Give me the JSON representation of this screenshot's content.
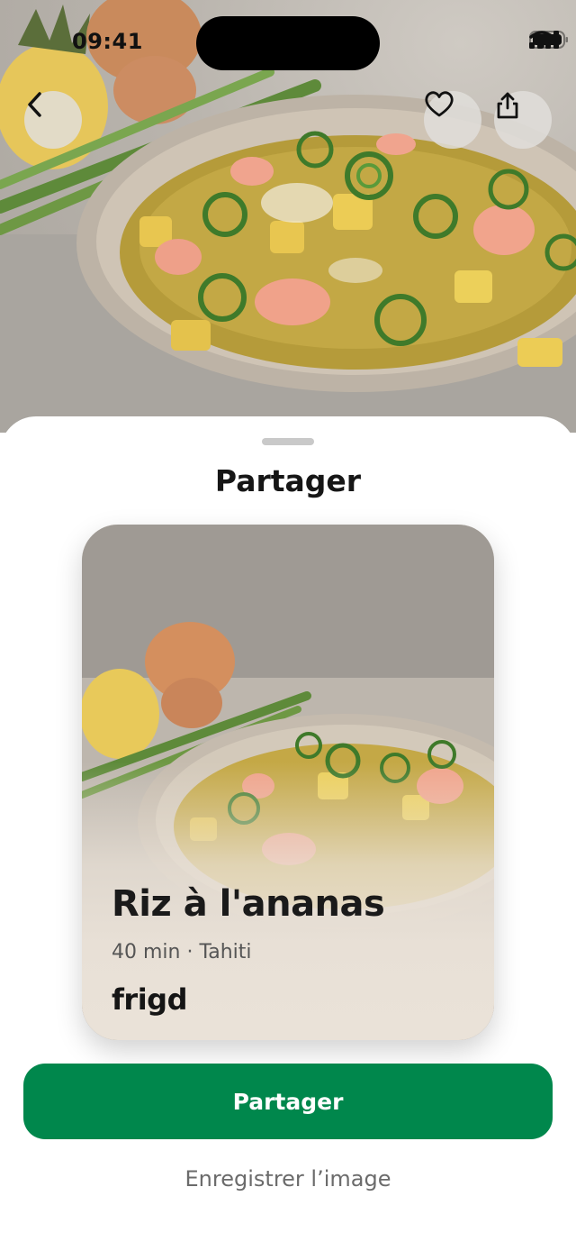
{
  "status_bar": {
    "time": "09:41"
  },
  "hero": {
    "image_subject": "pineapple rice dish photo",
    "back_icon": "chevron-left-icon",
    "like_icon": "heart-icon",
    "share_icon": "share-icon"
  },
  "sheet": {
    "title": "Partager"
  },
  "card": {
    "title": "Riz à l'ananas",
    "meta": "40 min · Tahiti",
    "brand": "frigd"
  },
  "actions": {
    "share_label": "Partager",
    "save_image_label": "Enregistrer l’image"
  },
  "colors": {
    "primary": "#00874c",
    "sheet_background": "#ffffff",
    "card_fade": "#eae2d8"
  }
}
